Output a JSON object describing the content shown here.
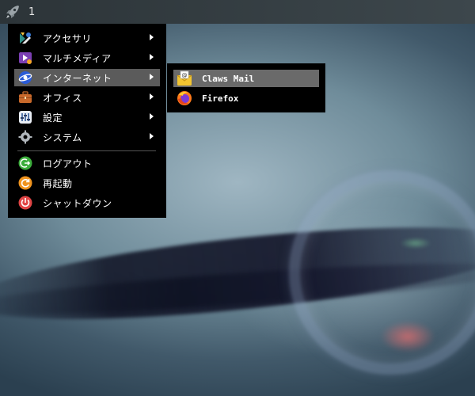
{
  "panel": {
    "launcher_icon": "rocket-icon",
    "workspace_label": "1"
  },
  "menu": {
    "items": [
      {
        "label": "アクセサリ",
        "icon": "accessories-icon",
        "has_submenu": true
      },
      {
        "label": "マルチメディア",
        "icon": "multimedia-icon",
        "has_submenu": true
      },
      {
        "label": "インターネット",
        "icon": "internet-icon",
        "has_submenu": true,
        "selected": true
      },
      {
        "label": "オフィス",
        "icon": "office-briefcase-icon",
        "has_submenu": true
      },
      {
        "label": "設定",
        "icon": "settings-icon",
        "has_submenu": true
      },
      {
        "label": "システム",
        "icon": "system-gear-icon",
        "has_submenu": true
      },
      {
        "label": "ログアウト",
        "icon": "logout-icon",
        "has_submenu": false
      },
      {
        "label": "再起動",
        "icon": "reboot-icon",
        "has_submenu": false
      },
      {
        "label": "シャットダウン",
        "icon": "power-icon",
        "has_submenu": false
      }
    ]
  },
  "submenu": {
    "items": [
      {
        "label": "Claws Mail",
        "icon": "claws-mail-icon",
        "selected": true
      },
      {
        "label": "Firefox",
        "icon": "firefox-icon"
      }
    ]
  },
  "colors": {
    "menu_bg": "#000000",
    "selected_bg": "#5b5b5b",
    "panel_bg": "#2c3438"
  }
}
